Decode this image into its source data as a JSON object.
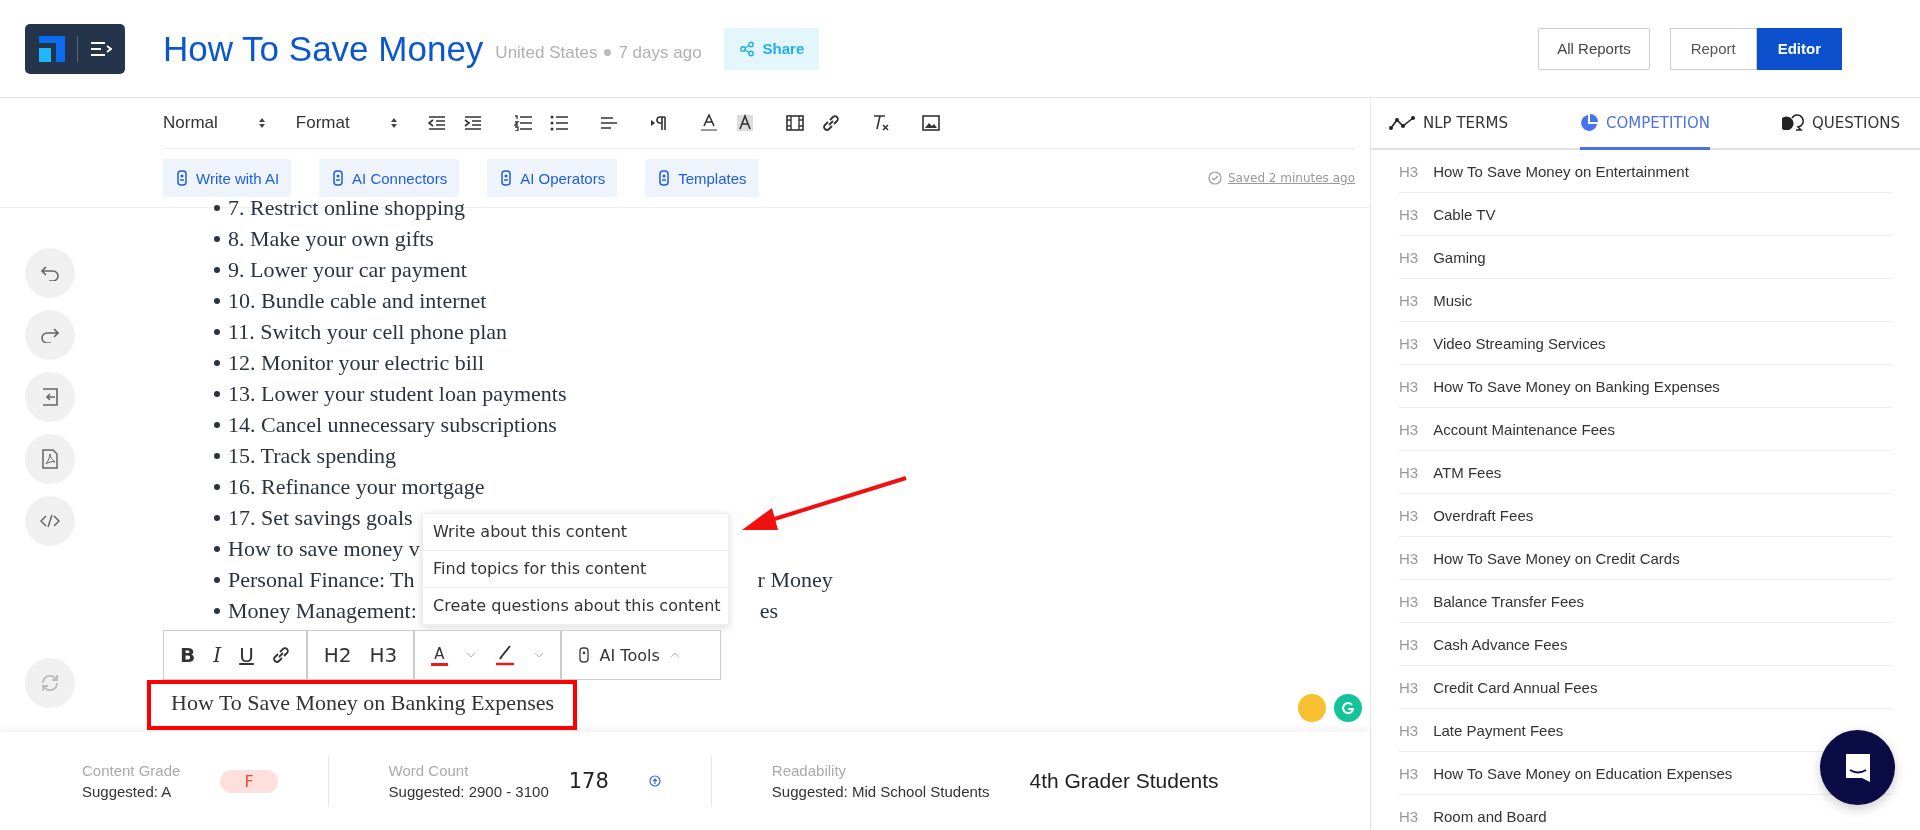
{
  "header": {
    "title": "How To Save Money",
    "country": "United States",
    "age": "7 days ago",
    "share": "Share",
    "all_reports": "All Reports",
    "views": [
      {
        "label": "Report",
        "selected": false
      },
      {
        "label": "Editor",
        "selected": true
      }
    ]
  },
  "toolbar": {
    "block_select": "Normal",
    "format_select": "Format",
    "ai_buttons": [
      "Write with AI",
      "AI Connectors",
      "AI Operators",
      "Templates"
    ],
    "saved": "Saved 2 minutes ago"
  },
  "editor": {
    "list_items": [
      {
        "left": "7. Restrict online shopping"
      },
      {
        "left": "8. Make your own gifts"
      },
      {
        "left": "9. Lower your car payment"
      },
      {
        "left": "10. Bundle cable and internet"
      },
      {
        "left": "11. Switch your cell phone plan"
      },
      {
        "left": "12. Monitor your electric bill"
      },
      {
        "left": "13. Lower your student loan payments"
      },
      {
        "left": "14. Cancel unnecessary subscriptions"
      },
      {
        "left": "15. Track spending"
      },
      {
        "left": "16. Refinance your mortgage"
      },
      {
        "left": "17. Set savings goals"
      },
      {
        "left": "How to save money v"
      },
      {
        "left": "Personal Finance: Th",
        "right": "r Money"
      },
      {
        "left": "Money Management:",
        "right": "es"
      }
    ],
    "heading": "How To Save Money on Banking Expenses",
    "context_menu": [
      "Write about this content",
      "Find topics for this content",
      "Create questions about this content"
    ],
    "float_toolbar": {
      "bold": "B",
      "italic": "I",
      "underline": "U",
      "h2": "H2",
      "h3": "H3",
      "text_color": "A",
      "ai_tools": "AI Tools"
    }
  },
  "panel": {
    "tabs": [
      {
        "label": "NLP TERMS",
        "selected": false,
        "kind": "terms"
      },
      {
        "label": "COMPETITION",
        "selected": true,
        "kind": "competition"
      },
      {
        "label": "QUESTIONS",
        "selected": false,
        "kind": "questions"
      }
    ],
    "items": [
      {
        "level": "H3",
        "text": "How To Save Money on Entertainment"
      },
      {
        "level": "H3",
        "text": "Cable TV"
      },
      {
        "level": "H3",
        "text": "Gaming"
      },
      {
        "level": "H3",
        "text": "Music"
      },
      {
        "level": "H3",
        "text": "Video Streaming Services"
      },
      {
        "level": "H3",
        "text": "How To Save Money on Banking Expenses"
      },
      {
        "level": "H3",
        "text": "Account Maintenance Fees"
      },
      {
        "level": "H3",
        "text": "ATM Fees"
      },
      {
        "level": "H3",
        "text": "Overdraft Fees"
      },
      {
        "level": "H3",
        "text": "How To Save Money on Credit Cards"
      },
      {
        "level": "H3",
        "text": "Balance Transfer Fees"
      },
      {
        "level": "H3",
        "text": "Cash Advance Fees"
      },
      {
        "level": "H3",
        "text": "Credit Card Annual Fees"
      },
      {
        "level": "H3",
        "text": "Late Payment Fees"
      },
      {
        "level": "H3",
        "text": "How To Save Money on Education Expenses"
      },
      {
        "level": "H3",
        "text": "Room and Board"
      }
    ]
  },
  "footer": {
    "grade_label": "Content Grade",
    "grade_suggested": "Suggested: A",
    "grade": "F",
    "words_label": "Word Count",
    "words_suggested": "Suggested: 2900 - 3100",
    "words": "178",
    "read_label": "Readability",
    "read_suggested": "Suggested: Mid School Students",
    "reading": "4th Grader Students"
  }
}
